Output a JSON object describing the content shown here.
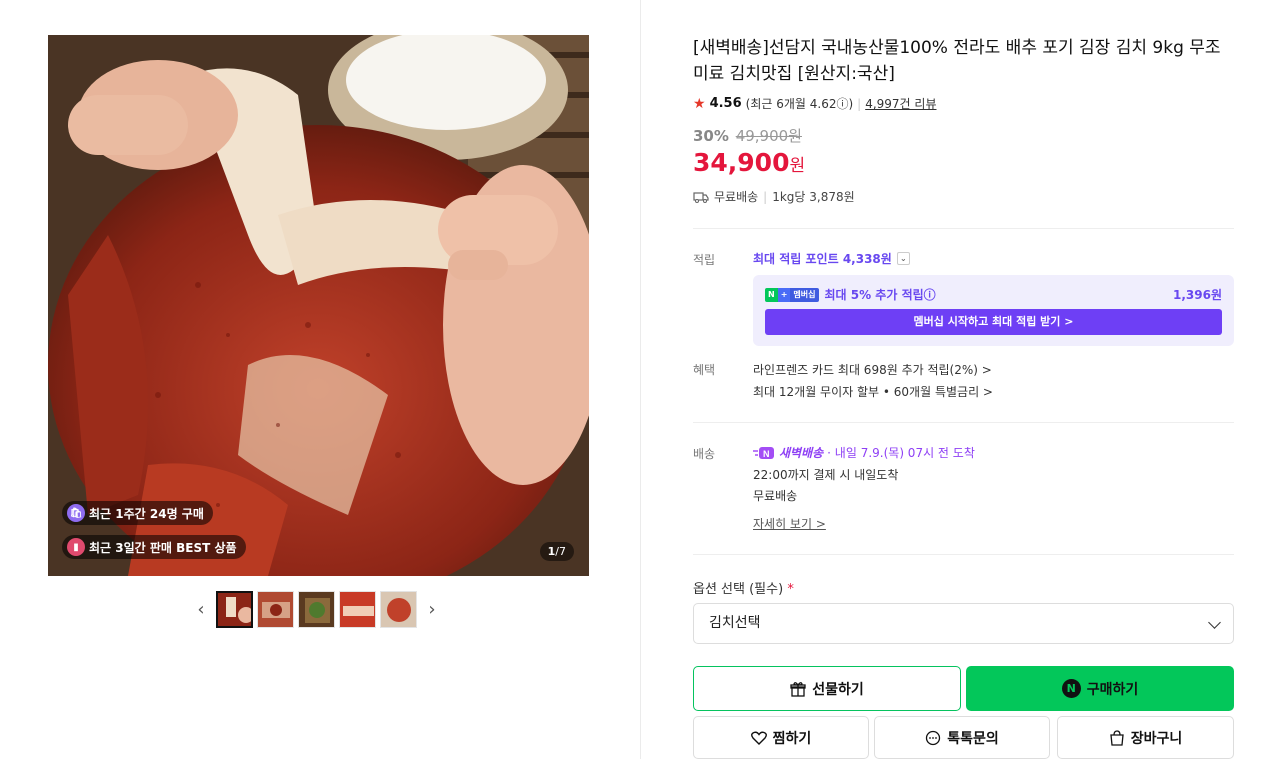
{
  "gallery": {
    "badge1": "최근 1주간 24명 구매",
    "badge2": "최근 3일간 판매 BEST 상품",
    "counter_current": "1",
    "counter_total": "/7"
  },
  "product": {
    "title": "[새벽배송]선담지 국내농산물100% 전라도 배추 포기 김장 김치 9kg 무조미료 김치맛집 [원산지:국산]",
    "rating": "4.56",
    "rating_recent": "(최근 6개월 4.62ⓘ)",
    "reviews": "4,997건 리뷰",
    "discount_pct": "30%",
    "original_price": "49,900원",
    "price": "34,900",
    "price_unit": "원",
    "shipping": "무료배송",
    "unit_price": "1kg당 3,878원"
  },
  "points": {
    "label": "적립",
    "max_points": "최대 적립 포인트 4,338원",
    "membership_tag_n": "N",
    "membership_tag_plus": "+",
    "membership_tag_m": "멤버십",
    "membership_text": "최대 5% 추가 적립ⓘ",
    "membership_amount": "1,396원",
    "membership_button": "멤버십 시작하고 최대 적립 받기 >"
  },
  "benefits": {
    "label": "혜택",
    "line1": "라인프렌즈 카드 최대 698원 추가 적립(2%) >",
    "line2": "최대 12개월 무이자 할부 • 60개월 특별금리 >"
  },
  "delivery": {
    "label": "배송",
    "badge": "새벽배송",
    "arrival": "· 내일 7.9.(목) 07시 전 도착",
    "cutoff": "22:00까지 결제 시 내일도착",
    "fee": "무료배송",
    "detail_link": "자세히 보기 >"
  },
  "options": {
    "label": "옵션 선택 (필수)",
    "required_mark": "*",
    "select_value": "김치선택"
  },
  "actions": {
    "gift": "선물하기",
    "buy": "구매하기",
    "wish": "찜하기",
    "talk": "톡톡문의",
    "cart": "장바구니"
  },
  "colors": {
    "price_red": "#e4163c",
    "naver_green": "#03c75a",
    "membership_purple": "#6e3ff5"
  }
}
